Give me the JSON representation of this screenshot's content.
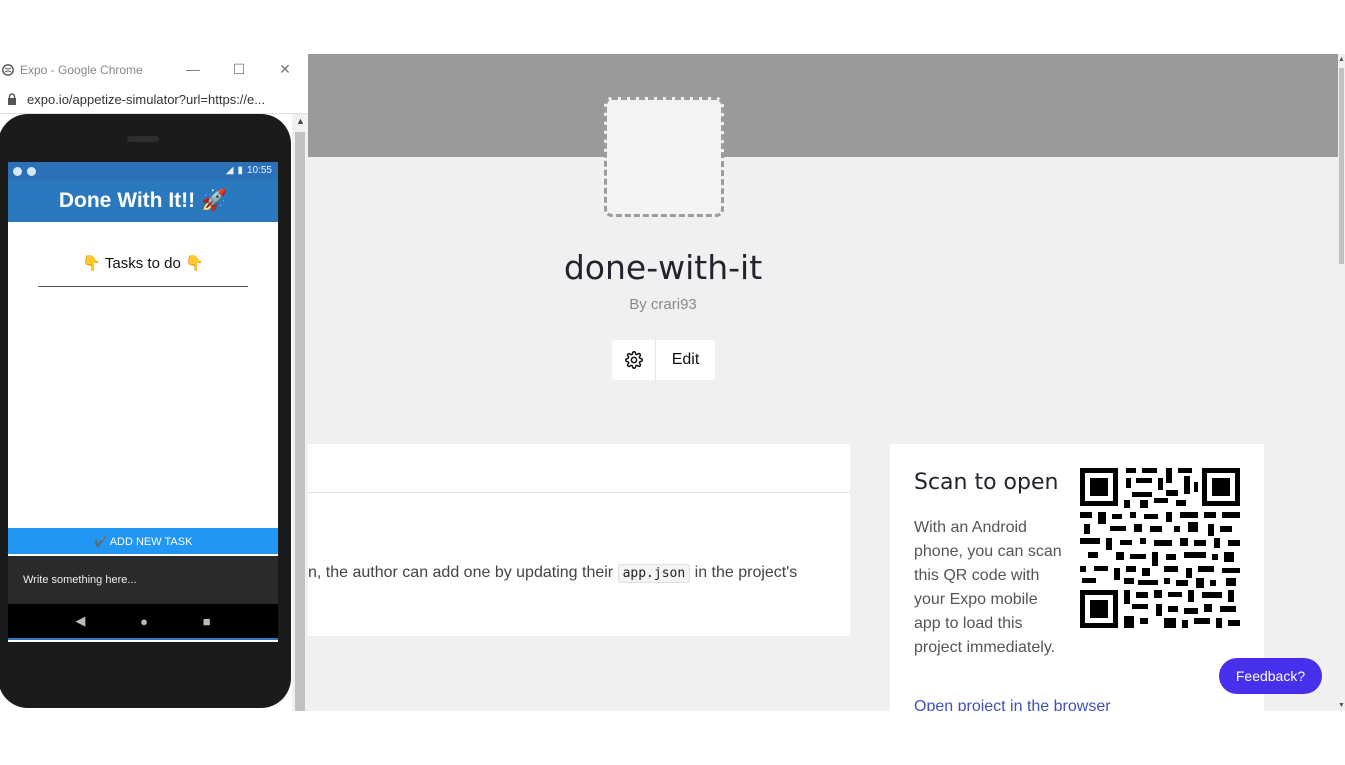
{
  "page": {
    "project_title": "done-with-it",
    "author": "By crari93",
    "edit_label": "Edit",
    "description_text_before": "n, the author can add one by updating their ",
    "description_code": "app.json",
    "description_text_after": " in the project's",
    "scan_title": "Scan to open",
    "scan_body": "With an Android phone, you can scan this QR code with your Expo mobile app to load this project immediately.",
    "open_link": "Open project in the browser",
    "feedback_label": "Feedback?"
  },
  "chrome": {
    "window_title": "Expo - Google Chrome",
    "url": "expo.io/appetize-simulator?url=https://e...",
    "minimize": "—",
    "maximize": "☐",
    "close": "✕"
  },
  "phone": {
    "time": "10:55",
    "app_title": "Done With It!! 🚀",
    "tasks_heading": "👇 Tasks to do 👇",
    "add_task_label": "✔️ ADD NEW TASK",
    "input_placeholder": "Write something here...",
    "nav_back": "◀",
    "nav_home": "●",
    "nav_recent": "■"
  },
  "colors": {
    "accent": "#4630eb",
    "app_header": "#2a78bd",
    "add_button": "#2196f3",
    "banner": "#9a9a9a"
  }
}
